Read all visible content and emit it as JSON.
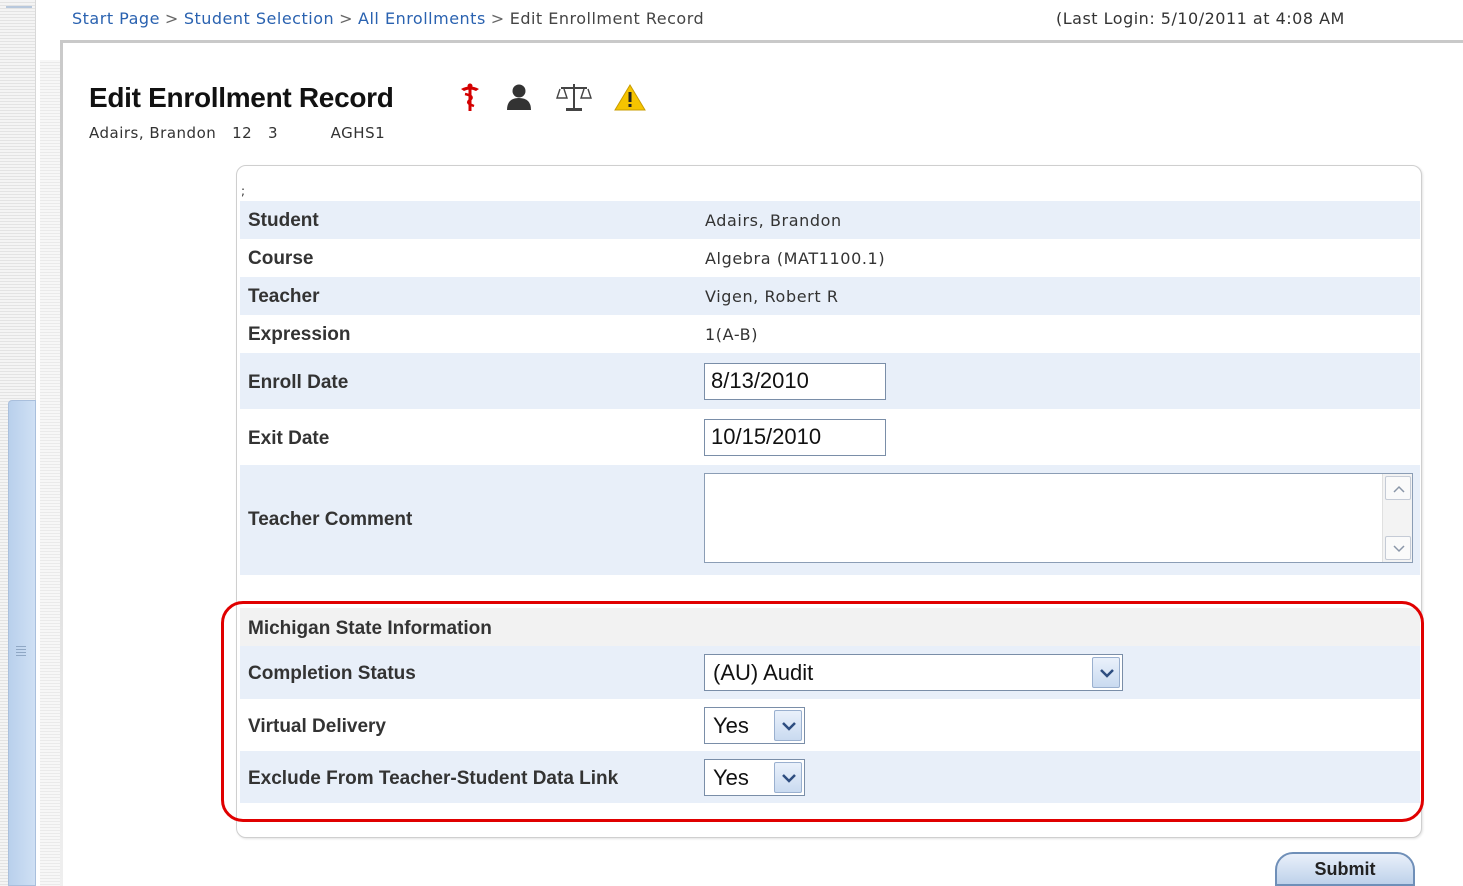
{
  "breadcrumb": {
    "links": [
      "Start Page",
      "Student Selection",
      "All Enrollments"
    ],
    "separator": ">",
    "current": "Edit Enrollment Record"
  },
  "last_login": "(Last Login: 5/10/2011 at 4:08 AM",
  "page": {
    "title": "Edit Enrollment Record",
    "subline": "Adairs, Brandon   12   3          AGHS1",
    "icons": [
      "medical-alert-icon",
      "person-icon",
      "legal-scales-icon",
      "warning-icon"
    ]
  },
  "form": {
    "stray_char": ";",
    "rows": [
      {
        "label": "Student",
        "value": "Adairs, Brandon"
      },
      {
        "label": "Course",
        "value": "Algebra (MAT1100.1)"
      },
      {
        "label": "Teacher",
        "value": "Vigen, Robert R"
      },
      {
        "label": "Expression",
        "value": "1(A-B)"
      }
    ],
    "enroll_date": {
      "label": "Enroll Date",
      "value": "8/13/2010"
    },
    "exit_date": {
      "label": "Exit Date",
      "value": "10/15/2010"
    },
    "teacher_comment": {
      "label": "Teacher Comment",
      "value": ""
    }
  },
  "state_info": {
    "header": "Michigan State Information",
    "completion_status": {
      "label": "Completion Status",
      "value": "(AU) Audit"
    },
    "virtual_delivery": {
      "label": "Virtual Delivery",
      "value": "Yes"
    },
    "exclude_link": {
      "label": "Exclude From Teacher-Student Data Link",
      "value": "Yes"
    }
  },
  "submit_label": "Submit",
  "colors": {
    "link": "#2a62b0",
    "row_alt": "#e8eff9",
    "highlight": "#e00000",
    "medical": "#d40000",
    "warning": "#f5c400"
  }
}
